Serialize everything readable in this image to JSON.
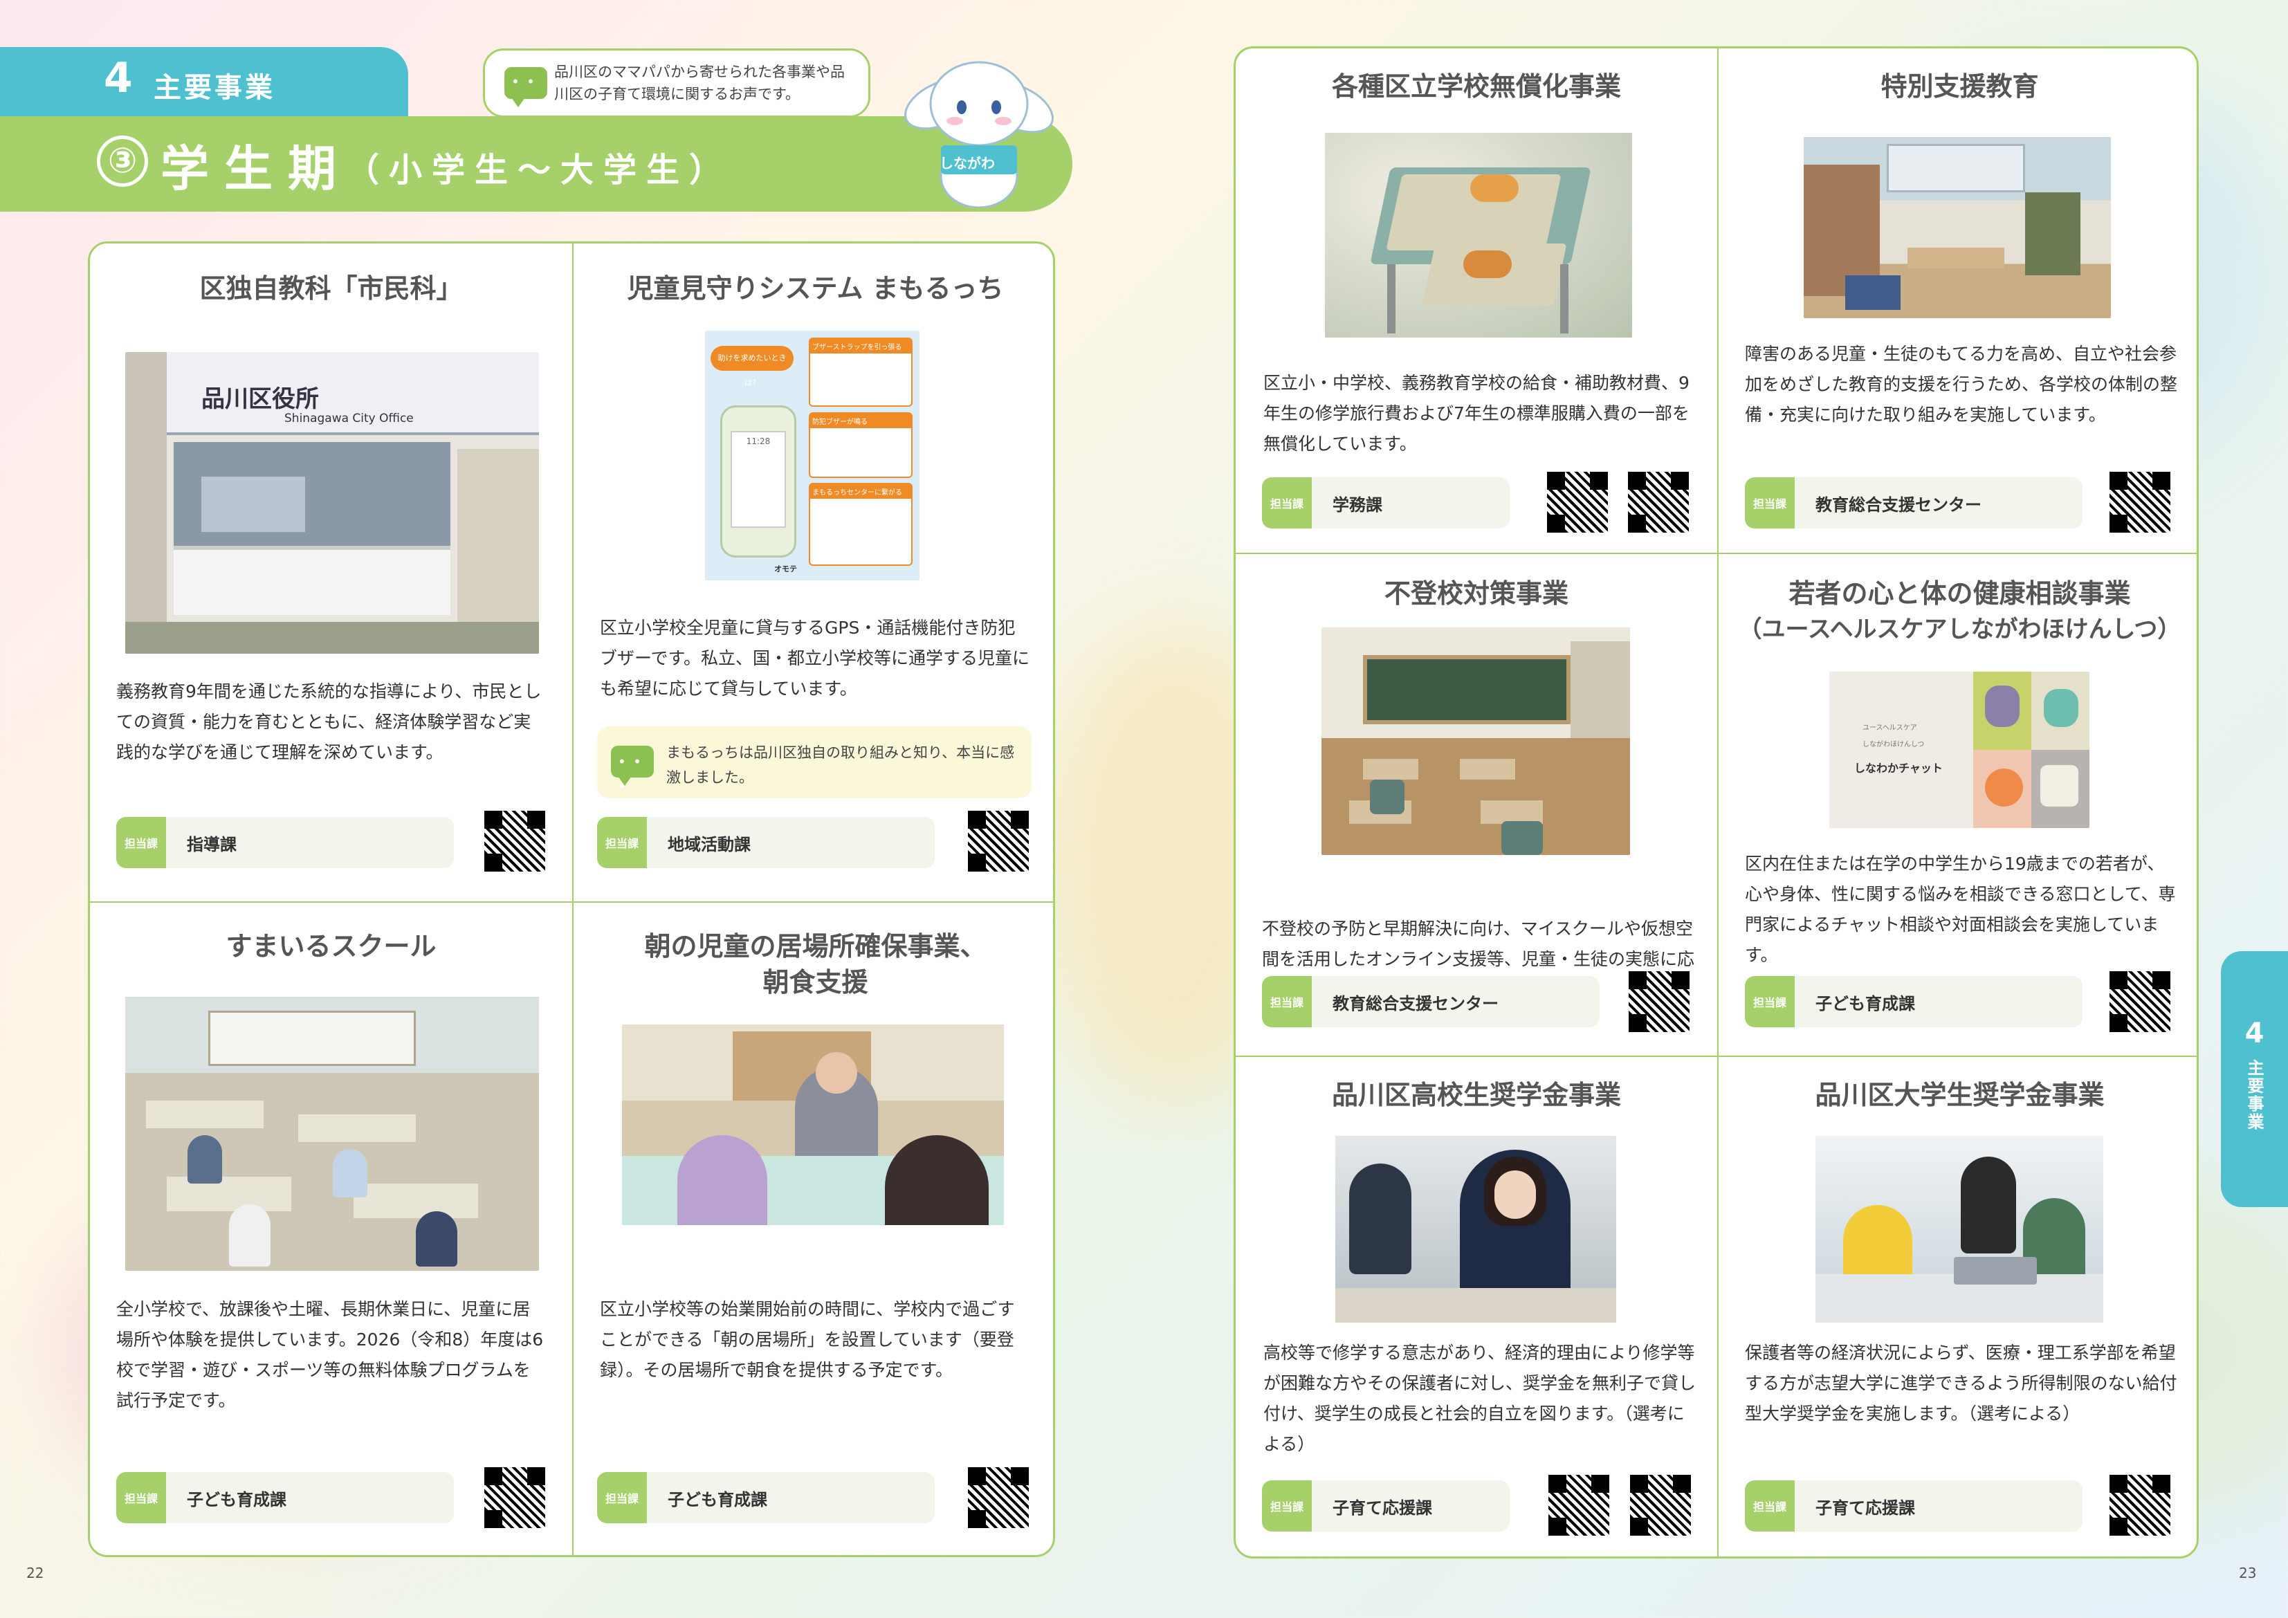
{
  "header": {
    "section_number": "4",
    "section_label": "主要事業",
    "phase_number": "③",
    "phase_title": "学生期",
    "phase_sub": "（小学生～大学生）",
    "bubble_text": "品川区のママパパから寄せられた各事業や品川区の子育て環境に関するお声です。",
    "mascot_badge": "しながわ"
  },
  "dept_tag": "担当課",
  "cards": {
    "shiminka": {
      "title": "区独自教科「市民科」",
      "photo_sign_jp": "品川区役所",
      "photo_sign_en": "Shinagawa City Office",
      "desc": "義務教育9年間を通じた系統的な指導により、市民としての資質・能力を育むとともに、経済体験学習など実践的な学びを通じて理解を深めています。",
      "dept": "指導課"
    },
    "mamorucchi": {
      "title": "児童見守りシステム まもるっち",
      "desc": "区立小学校全児童に貸与するGPS・通話機能付き防犯ブザーです。私立、国・都立小学校等に通学する児童にも希望に応じて貸与しています。",
      "note": "まもるっちは品川区独自の取り組みと知り、本当に感激しました。",
      "dept": "地域活動課"
    },
    "smile": {
      "title": "すまいるスクール",
      "desc": "全小学校で、放課後や土曜、長期休業日に、児童に居場所や体験を提供しています。2026（令和8）年度は6校で学習・遊び・スポーツ等の無料体験プログラムを試行予定です。",
      "dept": "子ども育成課"
    },
    "morning": {
      "title_line1": "朝の児童の居場所確保事業、",
      "title_line2": "朝食支援",
      "desc": "区立小学校等の始業開始前の時間に、学校内で過ごすことができる「朝の居場所」を設置しています（要登録）。その居場所で朝食を提供する予定です。",
      "dept": "子ども育成課"
    },
    "free": {
      "title": "各種区立学校無償化事業",
      "desc": "区立小・中学校、義務教育学校の給食・補助教材費、9年生の修学旅行費および7年生の標準服購入費の一部を無償化しています。",
      "dept": "学務課"
    },
    "special": {
      "title": "特別支援教育",
      "desc": "障害のある児童・生徒のもてる力を高め、自立や社会参加をめざした教育的支援を行うため、各学校の体制の整備・充実に向けた取り組みを実施しています。",
      "dept": "教育総合支援センター"
    },
    "futoko": {
      "title": "不登校対策事業",
      "desc": "不登校の予防と早期解決に向け、マイスクールや仮想空間を活用したオンライン支援等、児童・生徒の実態に応じたさまざまな支援を実施しています。",
      "dept": "教育総合支援センター"
    },
    "youth": {
      "title_line1": "若者の心と体の健康相談事業",
      "title_line2": "（ユースヘルスケアしながわほけんしつ）",
      "img_small1": "ユースヘルスケア",
      "img_small2": "しながわほけんしつ",
      "img_main": "しなわかチャット",
      "desc": "区内在住または在学の中学生から19歳までの若者が、心や身体、性に関する悩みを相談できる窓口として、専門家によるチャット相談や対面相談会を実施しています。",
      "dept": "子ども育成課"
    },
    "highschool": {
      "title": "品川区高校生奨学金事業",
      "desc": "高校等で修学する意志があり、経済的理由により修学等が困難な方やその保護者に対し、奨学金を無利子で貸し付け、奨学生の成長と社会的自立を図ります。（選考による）",
      "dept": "子育て応援課"
    },
    "university": {
      "title": "品川区大学生奨学金事業",
      "desc": "保護者等の経済状況によらず、医療・理工系学部を希望する方が志望大学に進学できるよう所得制限のない給付型大学奨学金を実施します。（選考による）",
      "dept": "子育て応援課"
    }
  },
  "flow": {
    "s1": "ブザーストラップを引っ張る",
    "s2": "防犯ブザーが鳴る",
    "s3": "まもるっちセンターに繋がる",
    "q": "助けを求めたいときは？",
    "screen_time": "11:28",
    "bottom_label": "オモテ"
  },
  "side_tab": {
    "number": "4",
    "label": "主要事業"
  },
  "page_numbers": {
    "left": "22",
    "right": "23"
  },
  "colors": {
    "accent_green": "#a6d16a",
    "accent_blue": "#4fc0cf"
  }
}
